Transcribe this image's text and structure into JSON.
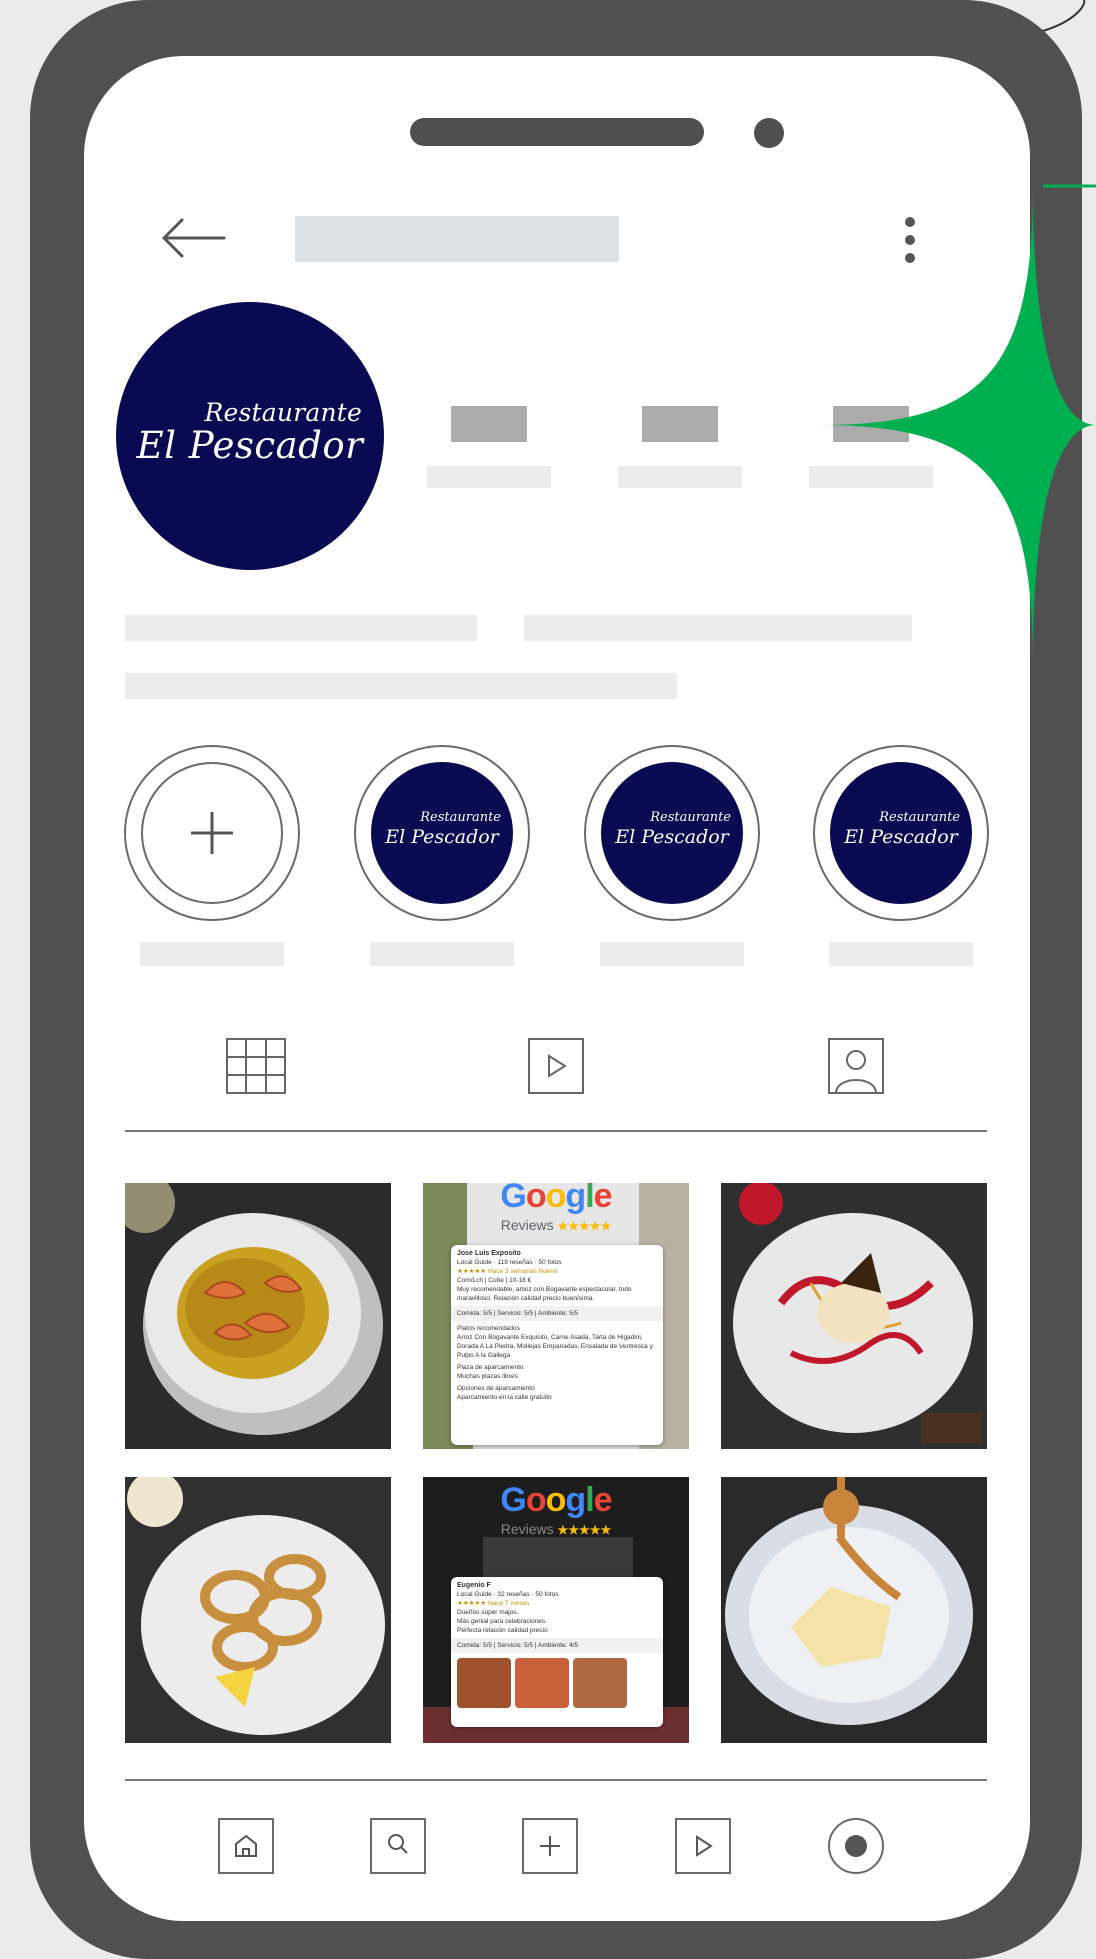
{
  "profile": {
    "logo_line1": "Restaurante",
    "logo_line2": "El Pescador"
  },
  "highlights": [
    {
      "type": "new",
      "symbol": "+"
    },
    {
      "type": "logo",
      "line1": "Restaurante",
      "line2": "El Pescador"
    },
    {
      "type": "logo",
      "line1": "Restaurante",
      "line2": "El Pescador"
    },
    {
      "type": "logo",
      "line1": "Restaurante",
      "line2": "El Pescador"
    }
  ],
  "tabs": [
    "grid-icon",
    "reels-icon",
    "tagged-icon"
  ],
  "posts": {
    "review1": {
      "google": "Google",
      "reviews": "Reviews",
      "stars": "★★★★★",
      "author": "Jose Luis Exposito",
      "author_meta": "Local Guide · 119 reseñas · 50 fotos",
      "rating_line": "★★★★★  Hace 3 semanas  Nuevo",
      "meta_line": "Com/Lch  |  Cube  |  10-18 €",
      "text": "Muy recomendable, amoz con Bogavante espectacular, todo maravilloso. Relación calidad precio buenísima.",
      "scores": "Comida: 5/5  |  Servicio: 5/5  |  Ambiente: 5/5",
      "dishes_label": "Platos recomendados",
      "dishes": "Arroz Con Bogavante Exquisito, Carne Asada, Tarta de Higadini, Dorada A La Piedra, Mollejas Empanadas, Ensalada de Ventresca y Pulpo A la Gallega",
      "parking_label": "Plaza de aparcamiento",
      "parking": "Muchas plazas libres",
      "options_label": "Opciones de aparcamiento",
      "options": "Aparcamiento en la calle gratuito"
    },
    "review2": {
      "google": "Google",
      "reviews": "Reviews",
      "stars": "★★★★★",
      "author": "Eugenio F",
      "author_meta": "Local Guide · 32 reseñas · 50 fotos",
      "rating_line": "★★★★★  Hace 7 meses",
      "text": "Dueños súper majos.\nMás genial para celebraciones.\nPerfecta relación calidad precio",
      "scores": "Comida: 5/5  |  Servicio: 5/5  |  Ambiente: 4/5"
    }
  },
  "bottom_nav": [
    "home-icon",
    "search-icon",
    "create-icon",
    "reels-icon",
    "profile-icon"
  ],
  "colors": {
    "phone_frame": "#505050",
    "logo_navy": "#090a52",
    "sparkle_green": "#00b050",
    "placeholder_dark": "#ababab",
    "placeholder_light": "#ececec"
  }
}
